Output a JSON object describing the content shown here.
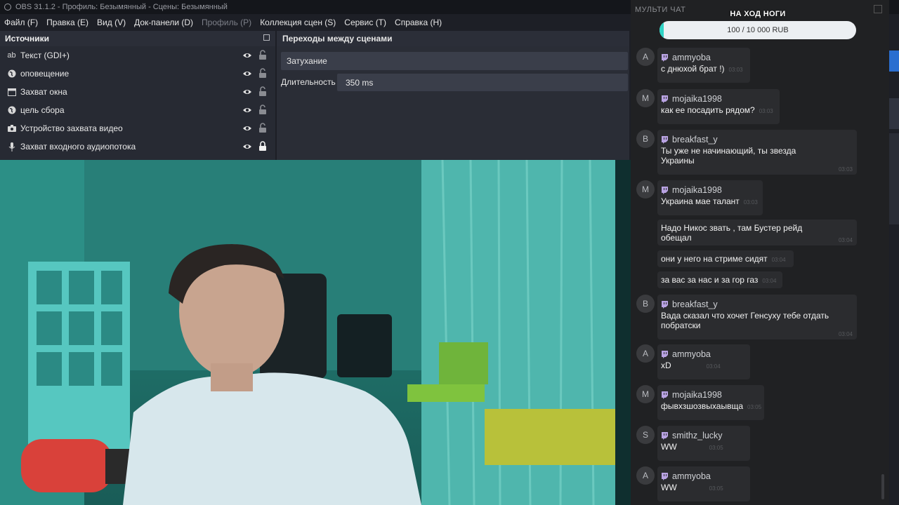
{
  "window": {
    "title": "OBS 31.1.2 - Профиль: Безымянный - Сцены: Безымянный"
  },
  "menu": [
    {
      "label": "Файл (F)",
      "enabled": true
    },
    {
      "label": "Правка (E)",
      "enabled": true
    },
    {
      "label": "Вид (V)",
      "enabled": true
    },
    {
      "label": "Док-панели (D)",
      "enabled": true
    },
    {
      "label": "Профиль (P)",
      "enabled": false
    },
    {
      "label": "Коллекция сцен (S)",
      "enabled": true
    },
    {
      "label": "Сервис (T)",
      "enabled": true
    },
    {
      "label": "Справка (H)",
      "enabled": true
    }
  ],
  "sources": {
    "title": "Источники",
    "items": [
      {
        "label": "Текст (GDI+)",
        "icon": "text-icon",
        "locked": false
      },
      {
        "label": "оповещение",
        "icon": "globe-icon",
        "locked": false
      },
      {
        "label": "Захват окна",
        "icon": "window-icon",
        "locked": false
      },
      {
        "label": "цель сбора",
        "icon": "globe-icon",
        "locked": false
      },
      {
        "label": "Устройство захвата видео",
        "icon": "camera-icon",
        "locked": false
      },
      {
        "label": "Захват входного аудиопотока",
        "icon": "microphone-icon",
        "locked": true
      }
    ]
  },
  "transitions": {
    "title": "Переходы между сценами",
    "selected": "Затухание",
    "duration_label": "Длительность",
    "duration_value": "350 ms"
  },
  "chat": {
    "header": "МУЛЬТИ ЧАТ",
    "goal": {
      "title": "НА ХОД НОГИ",
      "progress_text": "100 / 10 000 RUB",
      "progress_fraction": 0.01
    },
    "messages": [
      {
        "avatar": "A",
        "user": "ammyoba",
        "text": "с днюхой брат !)",
        "time": "03:03"
      },
      {
        "avatar": "M",
        "user": "mojaika1998",
        "text": "как ее посадить рядом?",
        "time": "03:03"
      },
      {
        "avatar": "B",
        "user": "breakfast_y",
        "text": "Ты уже не начинающий, ты звезда Украины",
        "time": "03:03"
      },
      {
        "avatar": "M",
        "user": "mojaika1998",
        "text": "Украина мае талант",
        "time": "03:03"
      },
      {
        "avatar": "",
        "user": "",
        "text": "Надо Никос звать , там Бустер рейд обещал",
        "time": "03:04"
      },
      {
        "avatar": "",
        "user": "",
        "text": "они у него на стриме сидят",
        "time": "03:04"
      },
      {
        "avatar": "",
        "user": "",
        "text": "за вас за нас и за гор газ",
        "time": "03:04"
      },
      {
        "avatar": "B",
        "user": "breakfast_y",
        "text": "Вада сказал что хочет Генсуху тебе отдать побратски",
        "time": "03:04"
      },
      {
        "avatar": "A",
        "user": "ammyoba",
        "text": "xD",
        "time": "03:04"
      },
      {
        "avatar": "M",
        "user": "mojaika1998",
        "text": "фывхзшозвыхаывща",
        "time": "03:05"
      },
      {
        "avatar": "S",
        "user": "smithz_lucky",
        "text": "WW",
        "time": "03:05"
      },
      {
        "avatar": "A",
        "user": "ammyoba",
        "text": "WW",
        "time": "03:05"
      }
    ]
  }
}
